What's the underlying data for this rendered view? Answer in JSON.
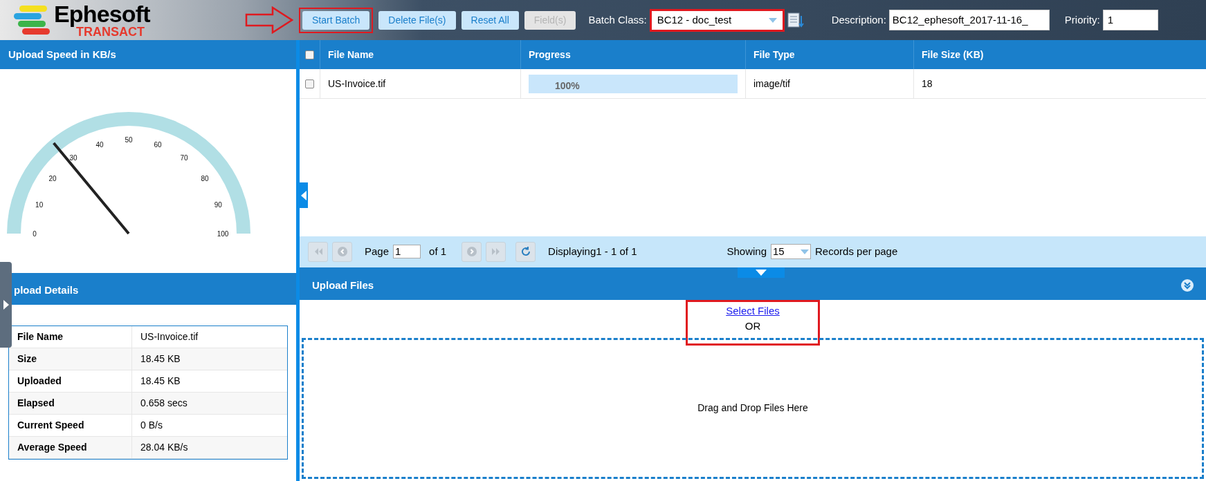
{
  "header": {
    "logo": {
      "name": "Ephesoft",
      "product": "TRANSACT"
    },
    "buttons": [
      {
        "label": "Start Batch",
        "disabled": false,
        "annotated": true
      },
      {
        "label": "Delete File(s)",
        "disabled": false,
        "annotated": false
      },
      {
        "label": "Reset All",
        "disabled": false,
        "annotated": false
      },
      {
        "label": "Field(s)",
        "disabled": true,
        "annotated": false
      }
    ],
    "batch_class": {
      "label": "Batch Class:",
      "value": "BC12 - doc_test",
      "annotated": true
    },
    "description": {
      "label": "Description:",
      "value": "BC12_ephesoft_2017-11-16_"
    },
    "priority": {
      "label": "Priority:",
      "value": "1"
    }
  },
  "speed_panel": {
    "title": "Upload Speed in KB/s",
    "gauge": {
      "level": 0.28,
      "ticks": [
        "0",
        "10",
        "20",
        "30",
        "40",
        "50",
        "60",
        "70",
        "80",
        "90",
        "100"
      ]
    }
  },
  "details_panel": {
    "title": "pload Details",
    "rows": [
      {
        "label": "File Name",
        "value": "US-Invoice.tif"
      },
      {
        "label": "Size",
        "value": "18.45 KB"
      },
      {
        "label": "Uploaded",
        "value": "18.45 KB"
      },
      {
        "label": "Elapsed",
        "value": "0.658 secs"
      },
      {
        "label": "Current Speed",
        "value": "0 B/s"
      },
      {
        "label": "Average Speed",
        "value": "28.04 KB/s"
      }
    ]
  },
  "table": {
    "all_checked": false,
    "columns": [
      "File Name",
      "Progress",
      "File Type",
      "File Size (KB)"
    ],
    "rows": [
      {
        "checked": false,
        "file_name": "US-Invoice.tif",
        "progress": {
          "level": 1,
          "text": "100%"
        },
        "file_type": "image/tif",
        "file_size": "18"
      }
    ]
  },
  "pagination": {
    "page_label": "Page",
    "page": "1",
    "of": "of 1",
    "displaying": "Displaying1 - 1 of 1",
    "showing": "Showing",
    "per_page": "15",
    "per_page_label": "Records per page"
  },
  "upload": {
    "title": "Upload Files",
    "select_files": "Select Files",
    "or": "OR",
    "annotated": true,
    "drop_text": "Drag and Drop Files Here"
  }
}
